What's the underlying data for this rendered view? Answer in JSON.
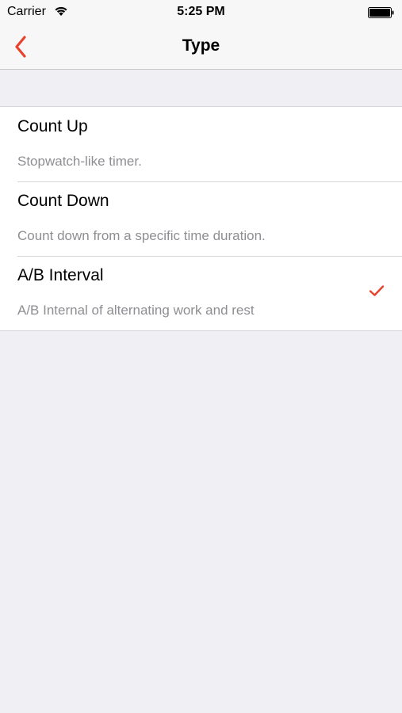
{
  "status_bar": {
    "carrier": "Carrier",
    "time": "5:25 PM"
  },
  "nav": {
    "title": "Type",
    "back_icon": "chevron-left-icon",
    "accent_color": "#e8412c"
  },
  "options": [
    {
      "title": "Count Up",
      "subtitle": "Stopwatch-like timer.",
      "selected": false
    },
    {
      "title": "Count Down",
      "subtitle": "Count down from a specific time duration.",
      "selected": false
    },
    {
      "title": "A/B Interval",
      "subtitle": "A/B Internal of alternating work and rest",
      "selected": true
    }
  ]
}
